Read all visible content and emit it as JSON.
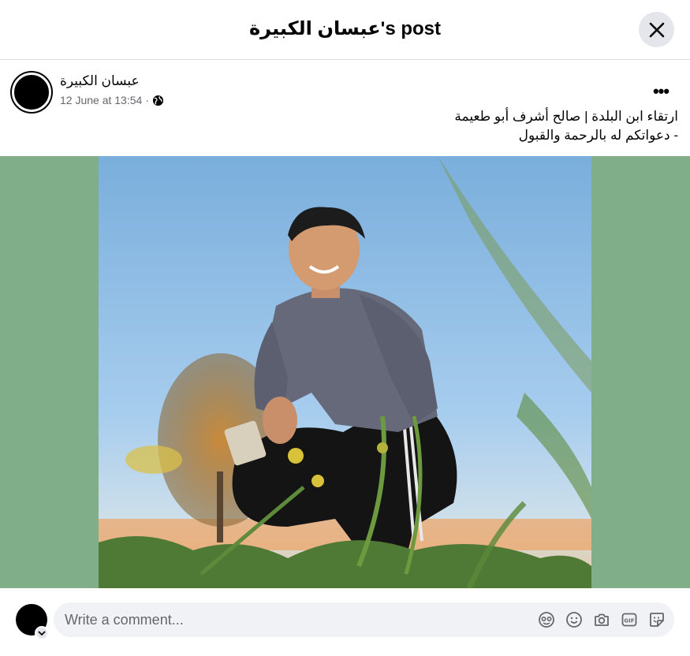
{
  "header": {
    "title": "عبسان الكبيرة's post",
    "close_icon": "close-icon"
  },
  "post": {
    "author": "عبسان الكبيرة",
    "timestamp": "12 June at 13:54",
    "separator": "·",
    "privacy_icon": "globe-icon",
    "more_icon": "more-icon",
    "more_label": "•••",
    "caption_line1": "ارتقاء ابن البلدة | صالح أشرف أبو طعيمة",
    "caption_line2": "- دعواتكم له بالرحمة والقبول"
  },
  "media": {
    "background_color": "#7fae88",
    "photo_description_icon": "photo"
  },
  "comment": {
    "placeholder": "Write a comment...",
    "icons": [
      "avatar-sticker-icon",
      "emoji-icon",
      "camera-icon",
      "gif-icon",
      "sticker-icon"
    ]
  },
  "colors": {
    "accent_gray": "#e4e6eb",
    "input_bg": "#f0f2f5",
    "secondary_text": "#65676b"
  }
}
